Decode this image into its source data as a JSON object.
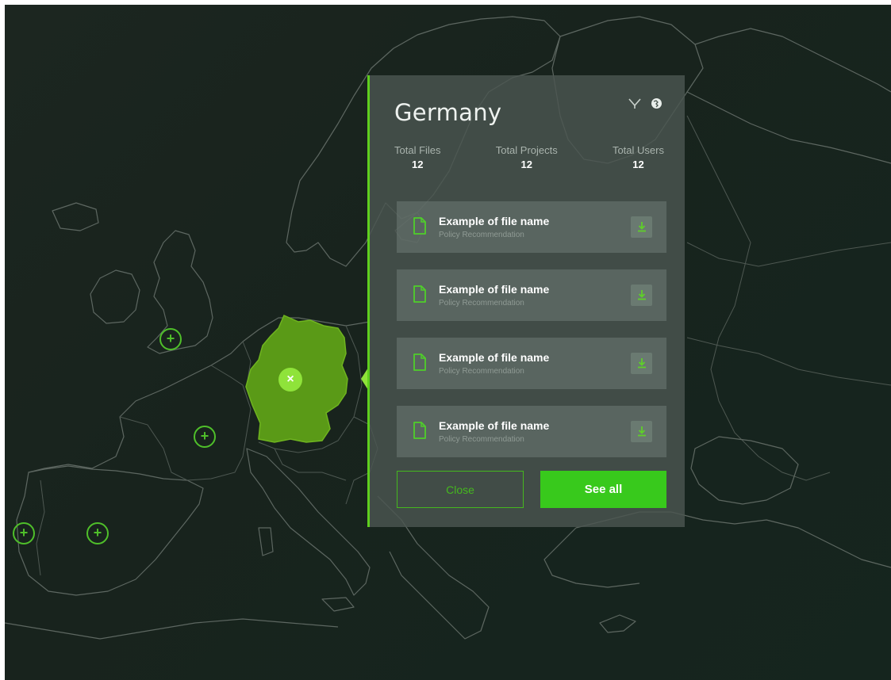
{
  "panel": {
    "title": "Germany",
    "stats": [
      {
        "label": "Total Files",
        "value": "12"
      },
      {
        "label": "Total Projects",
        "value": "12"
      },
      {
        "label": "Total Users",
        "value": "12"
      }
    ],
    "files": [
      {
        "name": "Example of file name",
        "type": "Policy Recommendation"
      },
      {
        "name": "Example of file name",
        "type": "Policy Recommendation"
      },
      {
        "name": "Example of file name",
        "type": "Policy Recommendation"
      },
      {
        "name": "Example of file name",
        "type": "Policy Recommendation"
      }
    ],
    "close_label": "Close",
    "see_all_label": "See all"
  },
  "map": {
    "selected_country": "Germany",
    "markers": [
      "plus-icon",
      "plus-icon",
      "plus-icon",
      "plus-icon",
      "plus-icon"
    ],
    "selected_marker_icon": "close-icon"
  },
  "colors": {
    "accent": "#38c91c",
    "selected_country_fill": "#5a9a17",
    "background": "#1a251f",
    "panel_bg": "#4a5650"
  }
}
